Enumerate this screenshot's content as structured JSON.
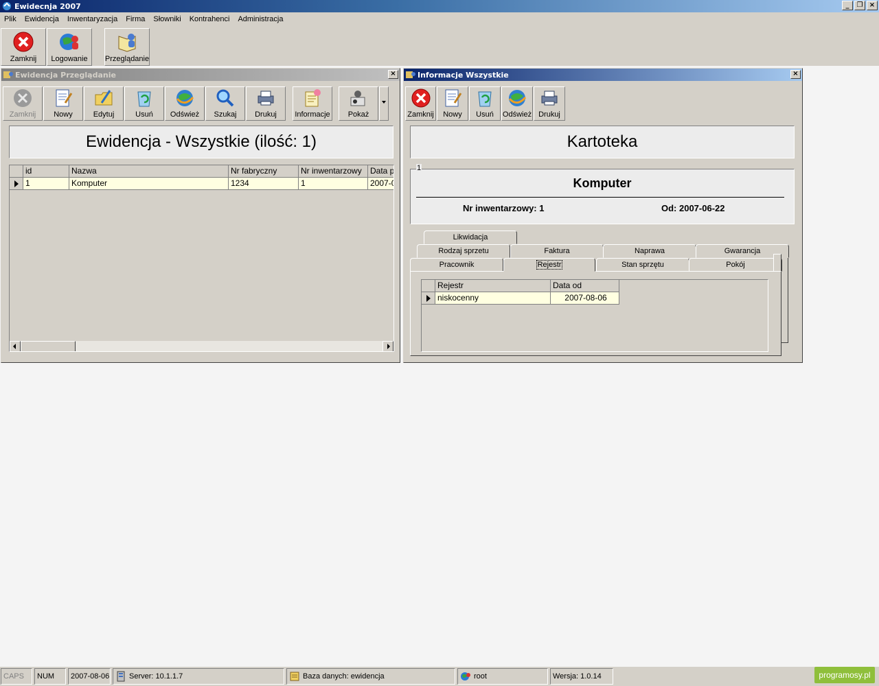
{
  "app": {
    "title": "Ewidecnja 2007"
  },
  "menu": [
    "Plik",
    "Ewidencja",
    "Inwentaryzacja",
    "Firma",
    "Słowniki",
    "Kontrahenci",
    "Administracja"
  ],
  "main_toolbar": {
    "close": "Zamknij",
    "login": "Logowanie",
    "browse": "Przeglądanie"
  },
  "left_window": {
    "title": "Ewidencja Przeglądanie",
    "toolbar": {
      "close": "Zamknij",
      "new": "Nowy",
      "edit": "Edytuj",
      "delete": "Usuń",
      "refresh": "Odśwież",
      "search": "Szukaj",
      "print": "Drukuj",
      "info": "Informacje",
      "show": "Pokaż"
    },
    "header": "Ewidencja - Wszystkie (ilość: 1)",
    "grid": {
      "columns": [
        "id",
        "Nazwa",
        "Nr fabryczny",
        "Nr inwentarzowy",
        "Data p"
      ],
      "rows": [
        [
          "1",
          "Komputer",
          "1234",
          "1",
          "2007-0"
        ]
      ]
    }
  },
  "right_window": {
    "title": "Informacje Wszystkie",
    "toolbar": {
      "close": "Zamknij",
      "new": "Nowy",
      "delete": "Usuń",
      "refresh": "Odśwież",
      "print": "Drukuj"
    },
    "header": "Kartoteka",
    "group_label": "1",
    "item_name": "Komputer",
    "inventory": "Nr inwentarzowy: 1",
    "since": "Od: 2007-06-22",
    "tabs": {
      "row1": [
        "Likwidacja"
      ],
      "row2": [
        "Rodzaj sprzetu",
        "Faktura",
        "Naprawa",
        "Gwarancja"
      ],
      "row3": [
        "Pracownik",
        "Rejestr",
        "Stan sprzętu",
        "Pokój"
      ]
    },
    "selected_tab": "Rejestr",
    "grid": {
      "columns": [
        "Rejestr",
        "Data od"
      ],
      "rows": [
        [
          "niskocenny",
          "2007-08-06"
        ]
      ]
    }
  },
  "status": {
    "caps": "CAPS",
    "num": "NUM",
    "date": "2007-08-06",
    "server": "Server: 10.1.1.7",
    "database": "Baza danych: ewidencja",
    "user": "root",
    "version": "Wersja: 1.0.14",
    "brand": "programosy.pl"
  }
}
